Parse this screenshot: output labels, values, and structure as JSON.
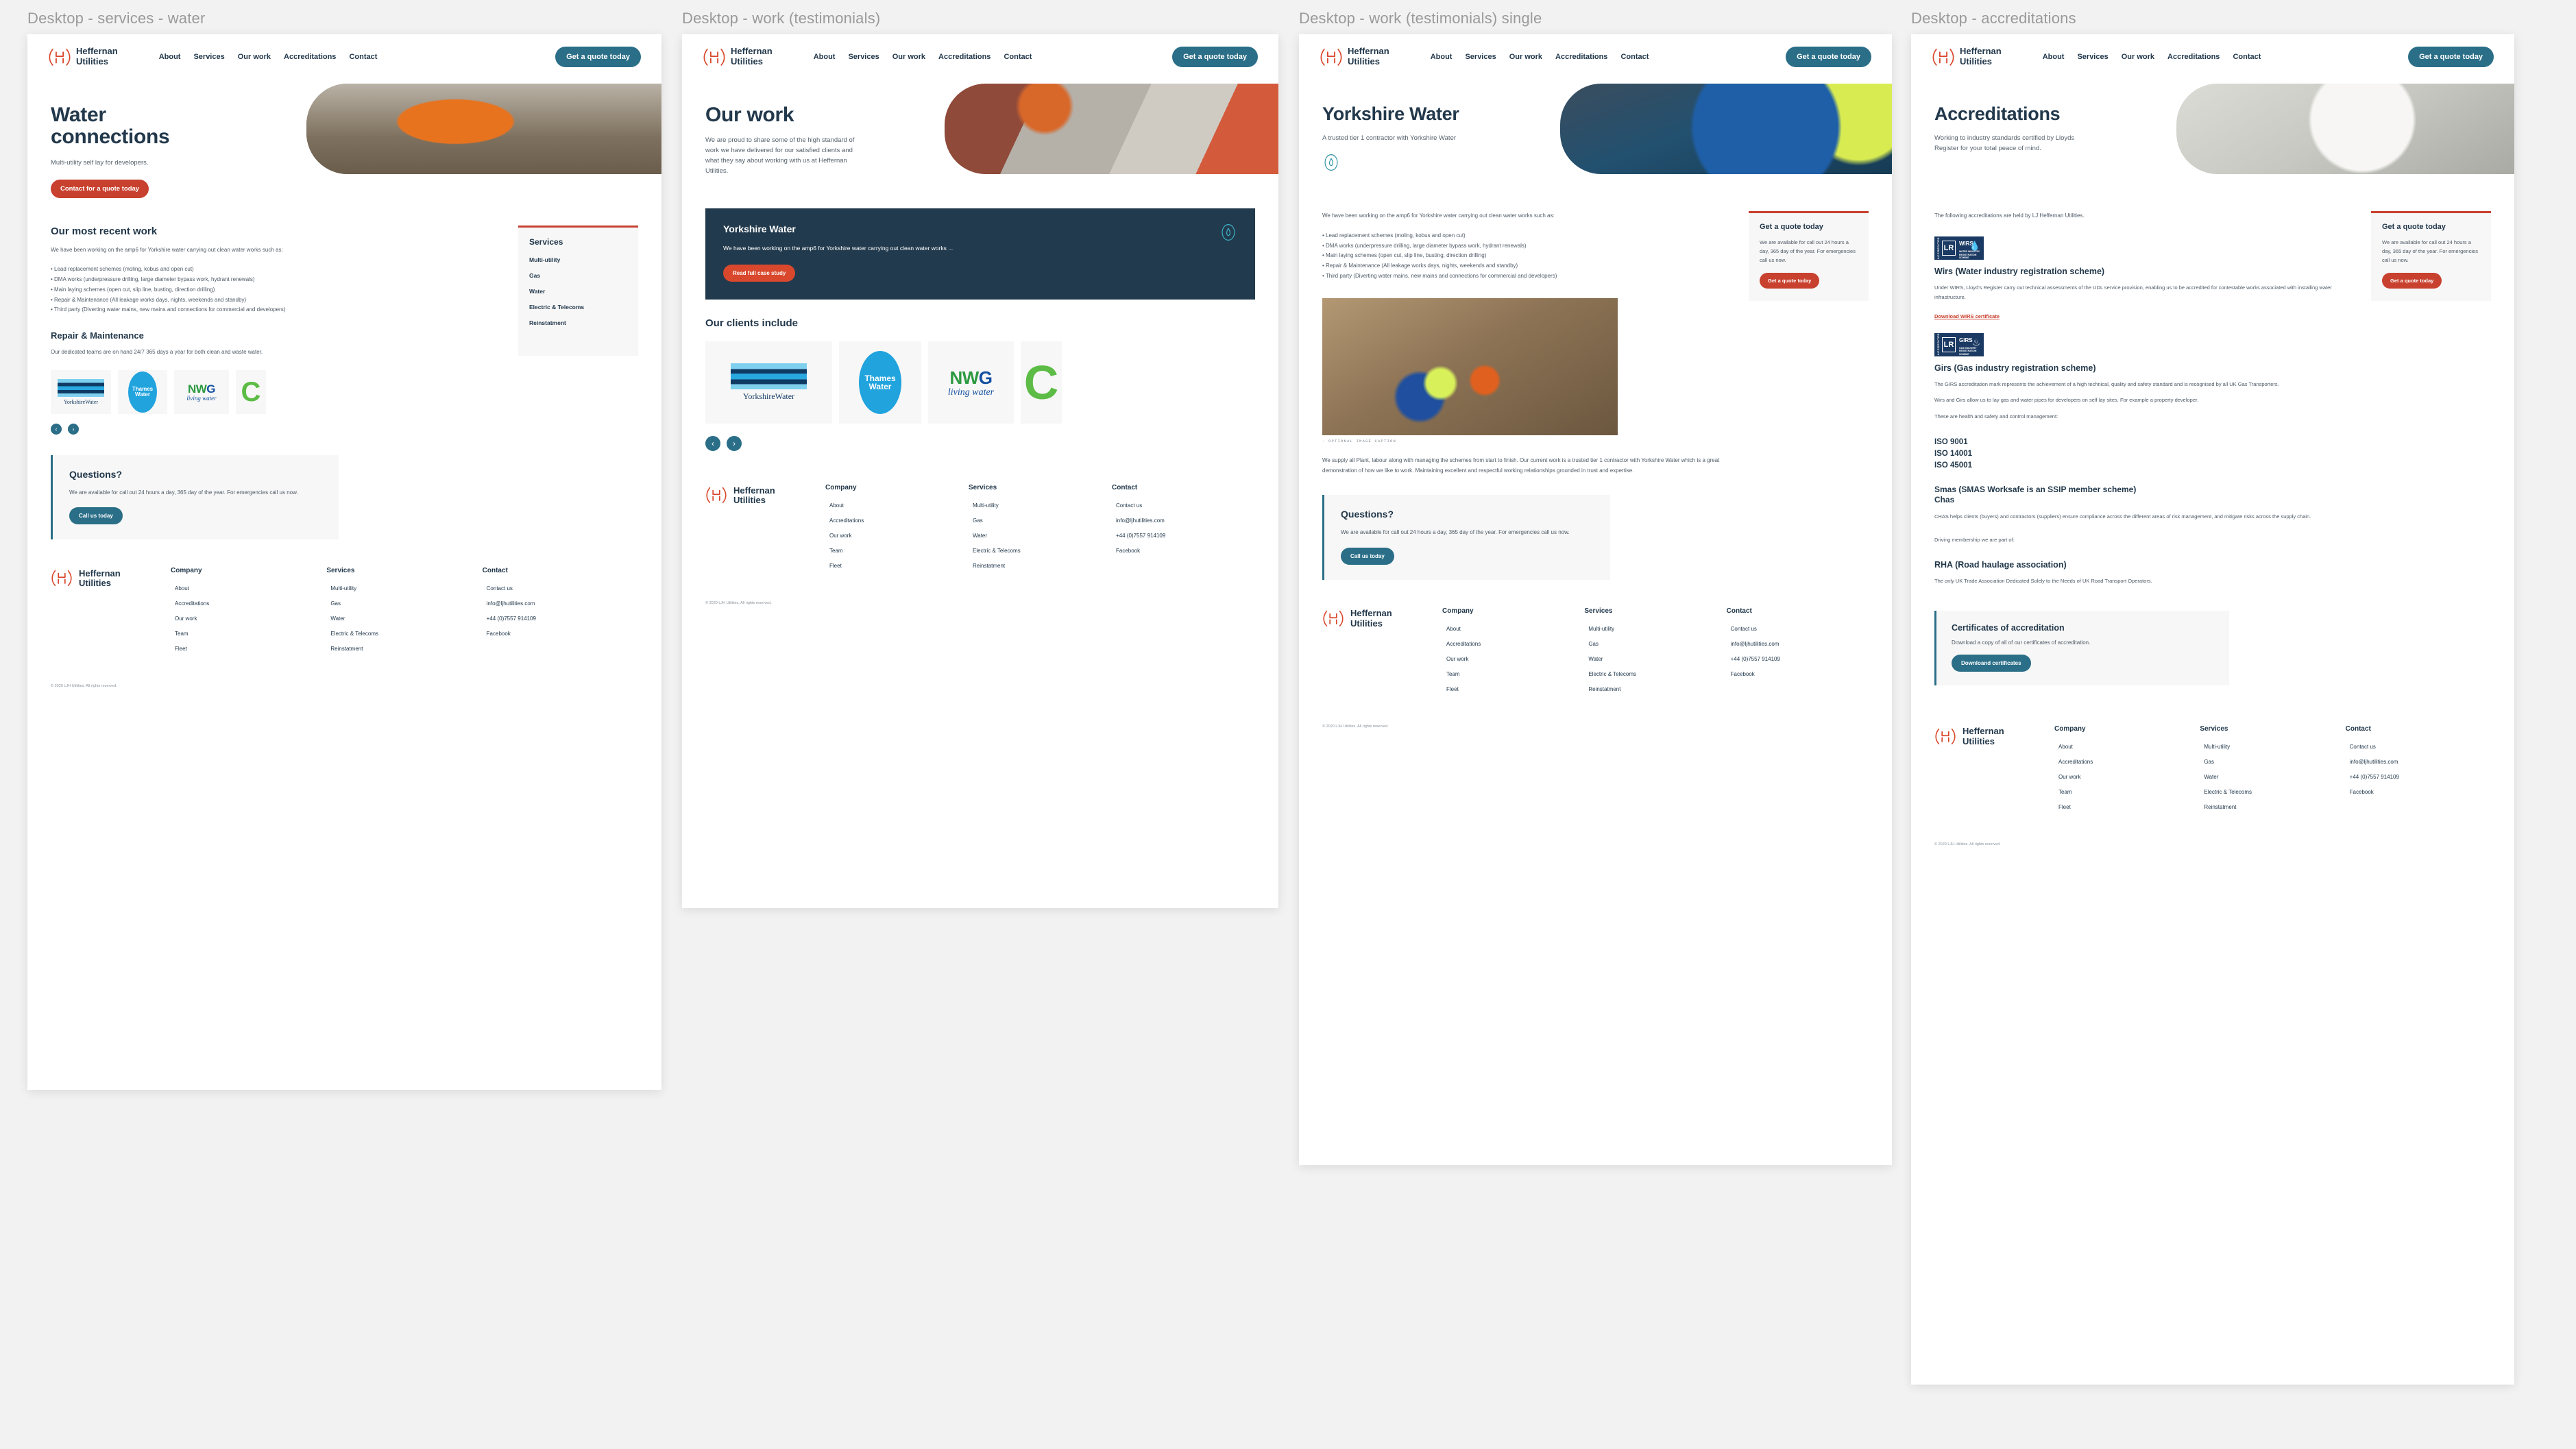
{
  "colors": {
    "brand_red": "#c8402e",
    "brand_teal": "#2a6e87",
    "navy": "#223a4d",
    "text_dark": "#22384b",
    "body_text": "#4e5a66",
    "panel_bg": "#f7f7f7",
    "badge_blue": "#1b3a63"
  },
  "frames": [
    {
      "label": "Desktop - services - water"
    },
    {
      "label": "Desktop - work (testimonials)"
    },
    {
      "label": "Desktop - work (testimonials) single"
    },
    {
      "label": "Desktop - accreditations"
    }
  ],
  "brand": {
    "name_line1": "Heffernan",
    "name_line2": "Utilities",
    "mark": "LJH"
  },
  "nav": {
    "links": [
      "About",
      "Services",
      "Our work",
      "Accreditations",
      "Contact"
    ],
    "cta": "Get a quote today"
  },
  "page_water": {
    "hero": {
      "title_line1": "Water",
      "title_line2": "connections",
      "subtitle": "Multi-utility self lay for developers.",
      "button": "Contact for a quote today"
    },
    "recent_work": {
      "heading": "Our most recent work",
      "intro": "We have been working on the amp6 for Yorkshire water carrying out clean water works such as:",
      "bullets": [
        "Lead replacement schemes (moling, kobus and open cut)",
        "DMA works (underpressure drilling, large diameter bypass work, hydrant renewals)",
        "Main laying schemes (open cut, slip line, busting, direction drilling)",
        "Repair & Maintenance (All leakage works days, nights, weekends and standby)",
        "Third party (Diverting water mains, new mains and connections for commercial and developers)"
      ]
    },
    "repair": {
      "heading": "Repair & Maintenance",
      "body": "Our dedicated teams are on hand 24/7 365 days a year for both clean and waste water."
    },
    "services_card": {
      "title": "Services",
      "items": [
        "Multi-utility",
        "Gas",
        "Water",
        "Electric & Telecoms",
        "Reinstatment"
      ]
    }
  },
  "page_work": {
    "hero": {
      "title": "Our work",
      "subtitle": "We are proud to share some of the high standard of work we have delivered for our satisfied clients and what they say about working with us at Heffernan Utilities."
    },
    "testimonial": {
      "title": "Yorkshire Water",
      "body": "We have been working on the amp6 for Yorkshire water carrying out clean water works ...",
      "button": "Read full case study"
    },
    "clients_heading": "Our clients include",
    "carousel": {
      "prev": "‹",
      "next": "›"
    }
  },
  "page_work_single": {
    "hero": {
      "title": "Yorkshire Water",
      "subtitle": "A trusted tier 1 contractor with Yorkshire Water"
    },
    "intro": "We have been working on the amp6 for Yorkshire water carrying out clean water works such as:",
    "bullets": [
      "Lead replacement schemes (moling, kobus and open cut)",
      "DMA works (underpressure drilling, large diameter bypass work, hydrant renewals)",
      "Main laying schemes (open cut, slip line, busting, direction drilling)",
      "Repair & Maintenance (All leakage works days, nights, weekends and standby)",
      "Third party (Diverting water mains, new mains and connections for commercial and developers)"
    ],
    "image_caption": "- OPTIONAL IMAGE CAPTION",
    "closing": "We supply all Plant, labour along with managing  the schemes from start to finish. Our current work is a trusted tier 1 contractor with Yorkshire Water which is a great demonstration of how we like to work. Maintaining excellent and respectful working relationships grounded in trust and expertise."
  },
  "page_accreditations": {
    "hero": {
      "title": "Accreditations",
      "subtitle": "Working to industry standards certified by Lloyds Register for your total peace of mind."
    },
    "intro": "The following accreditations are held by LJ Heffernan Utilities.",
    "wirs": {
      "badge_title": "WIRS",
      "badge_sub": "WATER INDUSTRY REGISTRATION SCHEME",
      "badge_accredited": "ACCREDITED",
      "heading": "Wirs (Water industry registration scheme)",
      "body": "Under WIRS, Lloyd's Register carry out technical assessments of the UDL service provision, enabling us to be accredited for contestable works associated with installing water infrastructure.",
      "link": "Download WIRS certificate"
    },
    "girs": {
      "badge_title": "GIRS",
      "badge_sub": "GAS INDUSTRY REGISTRATION SCHEME",
      "badge_accredited": "ACCREDITED",
      "heading": "Girs (Gas industry registration scheme)",
      "body1": "The GIRS accreditation mark represents the achievement of a high technical, quality and safety standard and is recognised by all UK Gas Transporters.",
      "body2": "Wirs and Girs allow us to lay gas and water pipes for developers on self lay sites. For example a property developer.",
      "body3": "These are health and safety and control management:"
    },
    "iso": "ISO 9001\nISO 14001\nISO 45001",
    "smas_heading": "Smas (SMAS Worksafe is an SSIP member scheme)\nChas",
    "chas_body": "CHAS helps clients (buyers) and contractors (suppliers) ensure compliance across the different areas of risk management, and mitigate risks across the supply chain.",
    "driving": "Driving membership we are part of:",
    "rha_heading": "RHA (Road haulage association)",
    "rha_body": "The only UK Trade Association Dedicated Solely to the Needs of UK Road Transport Operators.",
    "certificates": {
      "heading": "Certificates of accreditation",
      "body": "Download a copy of all of our certificates of accreditation.",
      "button": "Downloand certificates"
    }
  },
  "quote_box": {
    "title": "Get a quote today",
    "body": "We are available for call out 24 hours a day, 365 day of the year. For emergencies call us now.",
    "button": "Get a quote today"
  },
  "questions": {
    "title": "Questions?",
    "body": "We are available for call out 24 hours a day, 365 day of the year. For emergencies call us now.",
    "button": "Call us today"
  },
  "footer": {
    "company_title": "Company",
    "company_links": [
      "About",
      "Accreditations",
      "Our work",
      "Team",
      "Fleet"
    ],
    "services_title": "Services",
    "services_links": [
      "Multi-utility",
      "Gas",
      "Water",
      "Electric & Telecoms",
      "Reinstatment"
    ],
    "contact_title": "Contact",
    "contact_links": [
      "Contact us",
      "info@ljhutilities.com",
      "+44 (0)7557 914109",
      "Facebook"
    ],
    "copyright": "© 2020 LJH Utilities. All rights reserved."
  },
  "clients": [
    {
      "name": "YorkshireWater"
    },
    {
      "name": "Thames Water"
    },
    {
      "name": "NWG living water"
    },
    {
      "name": "Green partial logo"
    }
  ]
}
